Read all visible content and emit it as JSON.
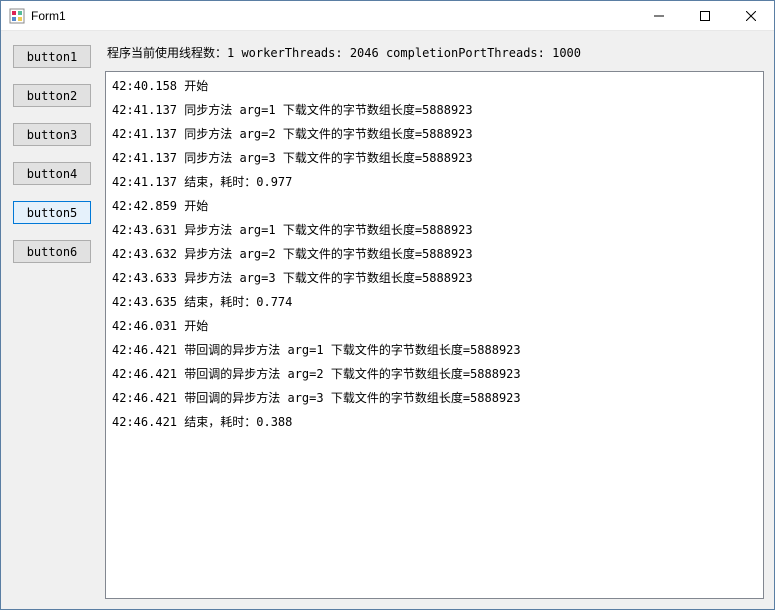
{
  "window": {
    "title": "Form1"
  },
  "buttons": [
    {
      "label": "button1",
      "selected": false
    },
    {
      "label": "button2",
      "selected": false
    },
    {
      "label": "button3",
      "selected": false
    },
    {
      "label": "button4",
      "selected": false
    },
    {
      "label": "button5",
      "selected": true
    },
    {
      "label": "button6",
      "selected": false
    }
  ],
  "status": {
    "text": "程序当前使用线程数：1   workerThreads: 2046   completionPortThreads: 1000"
  },
  "log_lines": [
    "42:40.158 开始",
    "42:41.137 同步方法 arg=1 下载文件的字节数组长度=5888923",
    "42:41.137 同步方法 arg=2 下载文件的字节数组长度=5888923",
    "42:41.137 同步方法 arg=3 下载文件的字节数组长度=5888923",
    "42:41.137 结束，耗时：0.977",
    "42:42.859 开始",
    "42:43.631 异步方法 arg=1 下载文件的字节数组长度=5888923",
    "42:43.632 异步方法 arg=2 下载文件的字节数组长度=5888923",
    "42:43.633 异步方法 arg=3 下载文件的字节数组长度=5888923",
    "42:43.635 结束，耗时：0.774",
    "42:46.031 开始",
    "42:46.421 带回调的异步方法 arg=1 下载文件的字节数组长度=5888923",
    "42:46.421 带回调的异步方法 arg=2 下载文件的字节数组长度=5888923",
    "42:46.421 带回调的异步方法 arg=3 下载文件的字节数组长度=5888923",
    "42:46.421 结束，耗时：0.388"
  ]
}
